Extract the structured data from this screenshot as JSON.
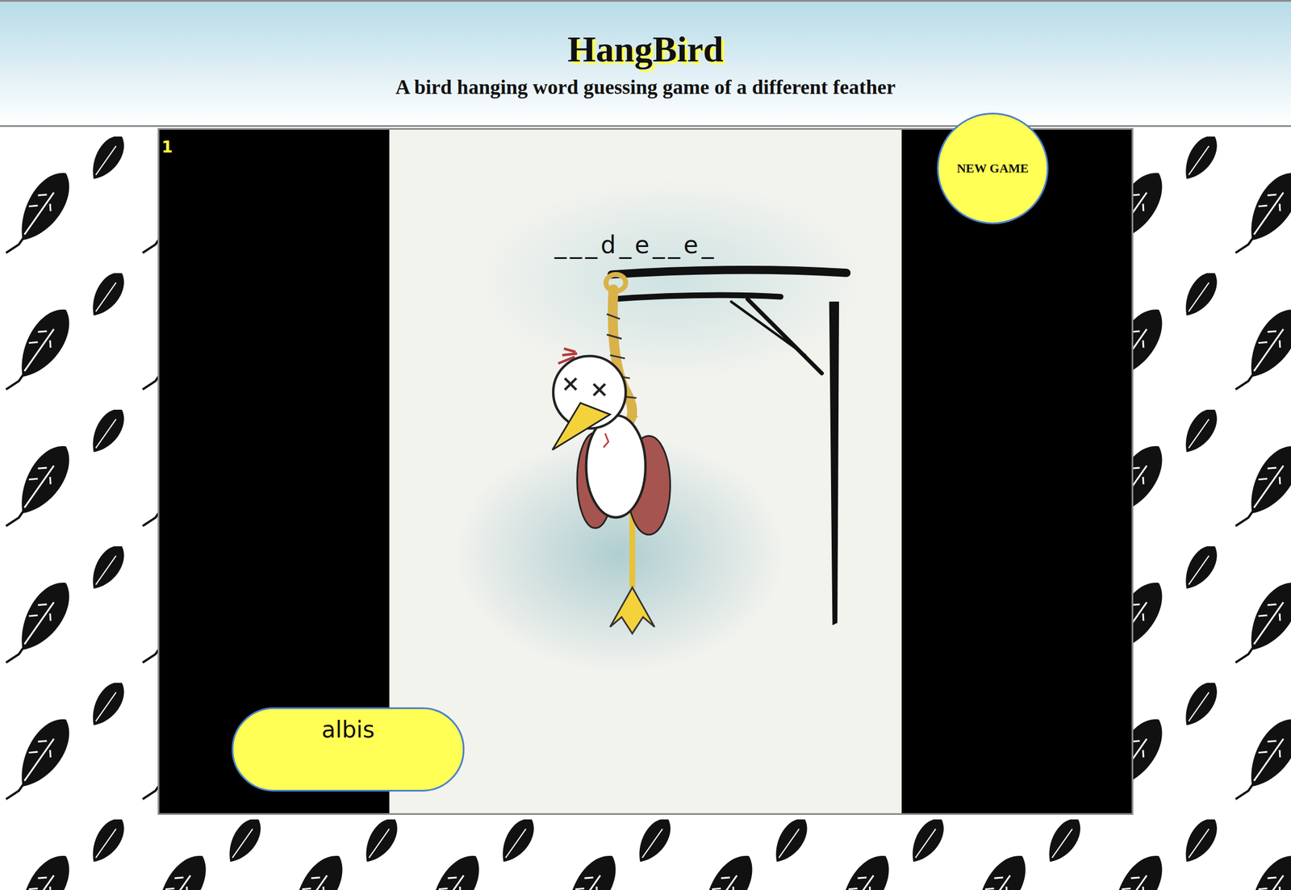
{
  "header": {
    "title": "HangBird",
    "subtitle": "A bird hanging word guessing game of a different feather"
  },
  "counter": "1",
  "new_game_button": "NEW GAME",
  "word": [
    "_",
    "_",
    "_",
    "d",
    "_",
    "e",
    "_",
    "_",
    "e",
    "_"
  ],
  "guess_input": {
    "value": "albis"
  },
  "bird": {
    "hanged": true
  }
}
